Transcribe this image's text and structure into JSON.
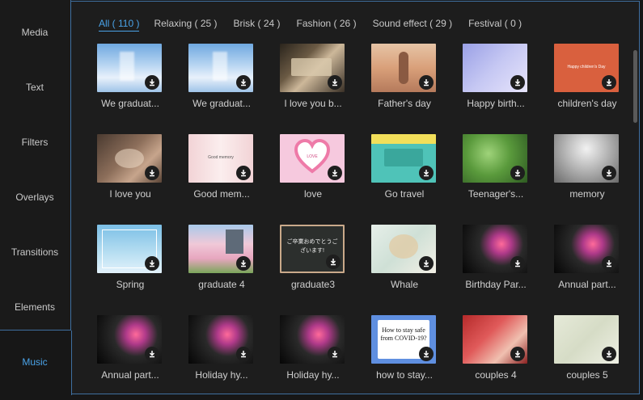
{
  "sidebar": {
    "items": [
      {
        "label": "Media"
      },
      {
        "label": "Text"
      },
      {
        "label": "Filters"
      },
      {
        "label": "Overlays"
      },
      {
        "label": "Transitions"
      },
      {
        "label": "Elements"
      },
      {
        "label": "Music"
      }
    ],
    "active_color": "#4aa3e8"
  },
  "tabs": [
    {
      "label": "All ( 110 )"
    },
    {
      "label": "Relaxing ( 25 )"
    },
    {
      "label": "Brisk ( 24 )"
    },
    {
      "label": "Fashion ( 26 )"
    },
    {
      "label": "Sound effect ( 29 )"
    },
    {
      "label": "Festival ( 0 )"
    }
  ],
  "items": [
    {
      "title": "We graduat...",
      "icon": "download-icon"
    },
    {
      "title": "We graduat...",
      "icon": "download-icon"
    },
    {
      "title": "I love you b...",
      "icon": "download-icon"
    },
    {
      "title": "Father's day",
      "icon": "download-icon"
    },
    {
      "title": "Happy birth...",
      "icon": "download-icon"
    },
    {
      "title": "children's day",
      "icon": "download-icon",
      "thumb_text": "Happy children's Day"
    },
    {
      "title": "I love you",
      "icon": "download-icon"
    },
    {
      "title": "Good mem...",
      "icon": "download-icon",
      "thumb_text": "Good memory"
    },
    {
      "title": "love",
      "icon": "download-icon",
      "thumb_text": "LOVE"
    },
    {
      "title": "Go travel",
      "icon": "download-icon"
    },
    {
      "title": "Teenager's...",
      "icon": "download-icon"
    },
    {
      "title": "memory",
      "icon": "download-icon"
    },
    {
      "title": "Spring",
      "icon": "download-icon"
    },
    {
      "title": "graduate 4",
      "icon": "download-icon"
    },
    {
      "title": "graduate3",
      "icon": "download-icon",
      "thumb_text": "ご卒業おめでとうございます!"
    },
    {
      "title": "Whale",
      "icon": "download-icon"
    },
    {
      "title": "Birthday Par...",
      "icon": "download-icon"
    },
    {
      "title": "Annual part...",
      "icon": "download-icon"
    },
    {
      "title": "Annual part...",
      "icon": "download-icon"
    },
    {
      "title": "Holiday hy...",
      "icon": "download-icon"
    },
    {
      "title": "Holiday hy...",
      "icon": "download-icon"
    },
    {
      "title": "how to stay...",
      "icon": "download-icon",
      "thumb_text": "How to stay safe from COVID-19?"
    },
    {
      "title": "couples 4",
      "icon": "download-icon"
    },
    {
      "title": "couples 5",
      "icon": "download-icon"
    }
  ]
}
